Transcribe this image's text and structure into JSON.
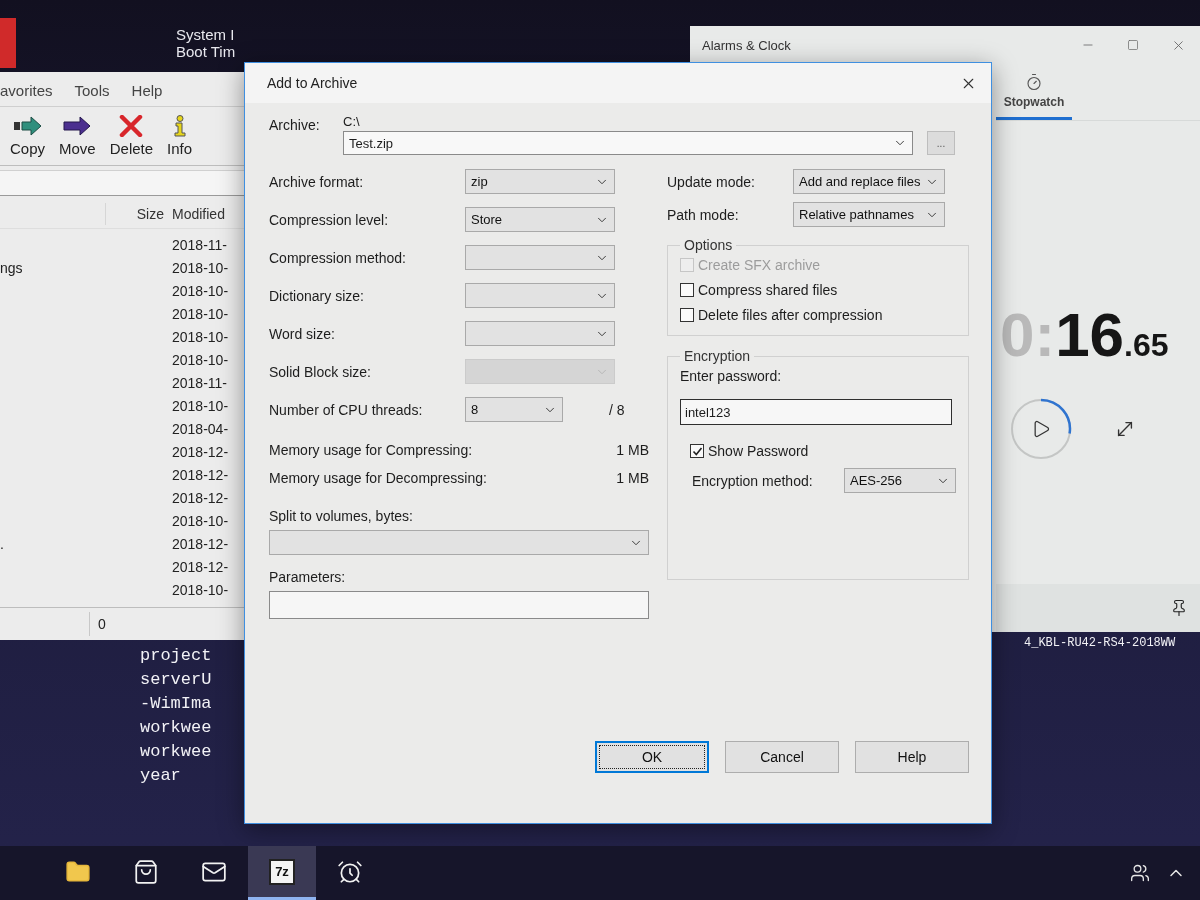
{
  "desktop": {
    "system_info": [
      "System I",
      "Boot Tim"
    ]
  },
  "file_manager": {
    "menu": [
      "avorites",
      "Tools",
      "Help"
    ],
    "toolbar": [
      {
        "kind": "copy",
        "label": "Copy"
      },
      {
        "kind": "move",
        "label": "Move"
      },
      {
        "kind": "delete",
        "label": "Delete"
      },
      {
        "kind": "info",
        "label": "Info"
      }
    ],
    "columns": [
      "Size",
      "Modified"
    ],
    "rows": [
      {
        "modified": "2018-11-"
      },
      {
        "name": "ngs",
        "modified": "2018-10-"
      },
      {
        "modified": "2018-10-"
      },
      {
        "modified": "2018-10-"
      },
      {
        "modified": "2018-10-"
      },
      {
        "modified": "2018-10-"
      },
      {
        "modified": "2018-11-"
      },
      {
        "modified": "2018-10-"
      },
      {
        "modified": "2018-04-"
      },
      {
        "modified": "2018-12-"
      },
      {
        "modified": "2018-12-"
      },
      {
        "modified": "2018-12-"
      },
      {
        "modified": "2018-10-"
      },
      {
        "name": ".",
        "modified": "2018-12-"
      },
      {
        "modified": "2018-12-"
      },
      {
        "modified": "2018-10-"
      }
    ],
    "status": "0"
  },
  "console": {
    "lines": [
      "project",
      "serverU",
      "-WimIma",
      "workwee",
      "workwee",
      "year"
    ],
    "right_line": "4_KBL-RU42-RS4-2018WW"
  },
  "clock_window": {
    "title": "Alarms & Clock",
    "tabs": [
      {
        "label": "Stopwatch",
        "selected": true
      }
    ],
    "time": {
      "dim": "0:",
      "main": "16",
      "fraction": ".65"
    }
  },
  "dialog": {
    "title": "Add to Archive",
    "archive": {
      "label": "Archive:",
      "folder": "C:\\",
      "value": "Test.zip",
      "browse": "..."
    },
    "left_fields": [
      {
        "label": "Archive format:",
        "value": "zip",
        "disabled": false
      },
      {
        "label": "Compression level:",
        "value": "Store",
        "disabled": false
      },
      {
        "label": "Compression method:",
        "disabled": false
      },
      {
        "label": "Dictionary size:",
        "disabled": false
      },
      {
        "label": "Word size:",
        "disabled": false
      },
      {
        "label": "Solid Block size:",
        "disabled": true
      }
    ],
    "cpu_threads": {
      "label": "Number of CPU threads:",
      "value": "8",
      "max": "/ 8"
    },
    "memory": [
      {
        "label": "Memory usage for Compressing:",
        "value": "1 MB"
      },
      {
        "label": "Memory usage for Decompressing:",
        "value": "1 MB"
      }
    ],
    "split": {
      "label": "Split to volumes, bytes:"
    },
    "parameters": {
      "label": "Parameters:"
    },
    "right_fields": [
      {
        "label": "Update mode:",
        "value": "Add and replace files"
      },
      {
        "label": "Path mode:",
        "value": "Relative pathnames"
      }
    ],
    "options": {
      "title": "Options",
      "items": [
        {
          "label": "Create SFX archive",
          "checked": false,
          "disabled": true
        },
        {
          "label": "Compress shared files",
          "checked": false,
          "disabled": false
        },
        {
          "label": "Delete files after compression",
          "checked": false,
          "disabled": false
        }
      ]
    },
    "encryption": {
      "title": "Encryption",
      "password_label": "Enter password:",
      "password": "intel123",
      "show_password": {
        "label": "Show Password",
        "checked": true
      },
      "method": {
        "label": "Encryption method:",
        "value": "AES-256"
      }
    },
    "buttons": [
      {
        "label": "OK",
        "default": true
      },
      {
        "label": "Cancel",
        "default": false
      },
      {
        "label": "Help",
        "default": false
      }
    ]
  },
  "taskbar": {
    "items": [
      {
        "kind": "folder",
        "selected": false
      },
      {
        "kind": "bag",
        "selected": false
      },
      {
        "kind": "mail",
        "selected": false
      },
      {
        "kind": "archiver",
        "label": "7z",
        "selected": true
      },
      {
        "kind": "clock",
        "selected": false
      }
    ],
    "tray": [
      {
        "kind": "people"
      },
      {
        "kind": "caret"
      }
    ]
  }
}
